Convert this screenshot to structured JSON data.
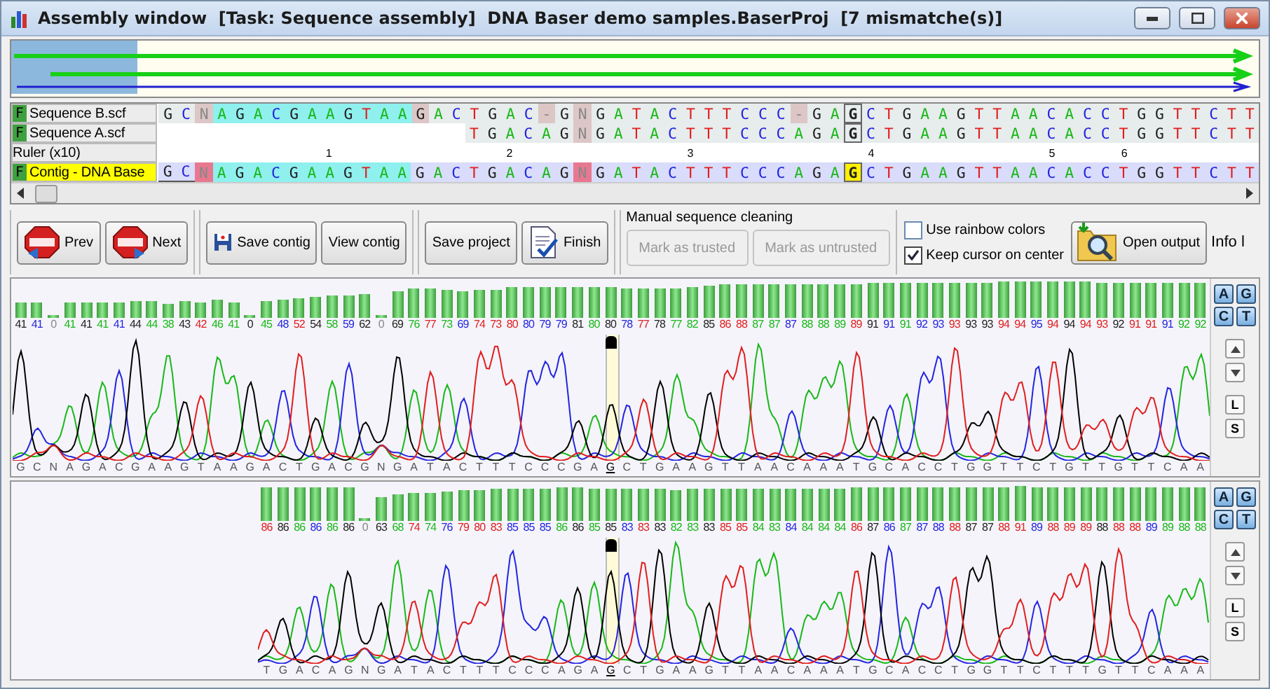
{
  "window": {
    "title": "Assembly window  [Task: Sequence assembly]  DNA Baser demo samples.BaserProj  [7 mismatche(s)]"
  },
  "alignment": {
    "rows": [
      {
        "kind": "sequence",
        "badge": "F",
        "name": "Sequence B.scf",
        "segments": [
          {
            "bases": "G C",
            "kind": "plain"
          },
          {
            "bases": "N",
            "kind": "mismatch"
          },
          {
            "bases": "A G A C G A A G T A A",
            "kind": "match"
          },
          {
            "bases": "G",
            "kind": "mismatch"
          },
          {
            "bases": "A C T G A C",
            "kind": "plain"
          },
          {
            "bases": "-",
            "kind": "mismatch"
          },
          {
            "bases": "G",
            "kind": "plain"
          },
          {
            "bases": "N",
            "kind": "mismatch"
          },
          {
            "bases": "G A T A C T T T C C C",
            "kind": "plain"
          },
          {
            "bases": "-",
            "kind": "mismatch"
          },
          {
            "bases": "G A",
            "kind": "plain"
          },
          {
            "bases": "G",
            "kind": "cursor"
          },
          {
            "bases": "C T G A A G T T A A C A C C T G G T T C T T",
            "kind": "plain"
          }
        ]
      },
      {
        "kind": "sequence",
        "badge": "F",
        "name": "Sequence A.scf",
        "segments": [
          {
            "bases": "T G A C A G",
            "kind": "plain"
          },
          {
            "bases": "N",
            "kind": "mismatch"
          },
          {
            "bases": "G A T A C T T T C C C A G A",
            "kind": "plain"
          },
          {
            "bases": "G",
            "kind": "cursor"
          },
          {
            "bases": "C T G A A G T T A A C A C C T G G T T C T T",
            "kind": "plain"
          }
        ]
      },
      {
        "kind": "ruler",
        "name": "Ruler (x10)",
        "marks": [
          "1",
          "2",
          "3",
          "4",
          "5",
          "6"
        ]
      },
      {
        "kind": "contig",
        "badge": "F",
        "name": "Contig - DNA Base",
        "segments": [
          {
            "bases": "G C",
            "kind": "trimmed"
          },
          {
            "bases": "N",
            "kind": "error"
          },
          {
            "bases": "A G A C G A A G T A A",
            "kind": "match"
          },
          {
            "bases": "G A C T G A C A G",
            "kind": "contig"
          },
          {
            "bases": "N",
            "kind": "error"
          },
          {
            "bases": "G A T A C T T T C C C A G A",
            "kind": "contig"
          },
          {
            "bases": "G",
            "kind": "cursor-marked"
          },
          {
            "bases": "C T G A A G T T A A C A C C T G G T T C T T",
            "kind": "contig"
          }
        ]
      }
    ]
  },
  "toolbar": {
    "groups": [
      {
        "buttons": [
          {
            "label": "Prev"
          },
          {
            "label": "Next"
          }
        ]
      },
      {
        "buttons": [
          {
            "label": "Save contig"
          },
          {
            "label": "View contig"
          }
        ]
      },
      {
        "buttons": [
          {
            "label": "Save project"
          },
          {
            "label": "Finish"
          }
        ]
      }
    ],
    "cleaning": {
      "title": "Manual sequence cleaning",
      "buttons": [
        {
          "label": "Mark as trusted",
          "disabled": true
        },
        {
          "label": "Mark as untrusted",
          "disabled": true
        }
      ]
    },
    "options": [
      {
        "label": "Use rainbow colors",
        "checked": false
      },
      {
        "label": "Keep cursor on center",
        "checked": true
      }
    ],
    "output_button": {
      "label": "Open output"
    },
    "info_label": "Info l"
  },
  "chromatograms": [
    {
      "side_buttons": [
        "A",
        "G",
        "C",
        "T"
      ],
      "buttons": [
        "L",
        "S"
      ],
      "calls": [
        {
          "b": "G",
          "q": "41"
        },
        {
          "b": "C",
          "q": "41"
        },
        {
          "b": "N",
          "q": "0"
        },
        {
          "b": "A",
          "q": "41"
        },
        {
          "b": "G",
          "q": "41"
        },
        {
          "b": "A",
          "q": "41"
        },
        {
          "b": "C",
          "q": "41"
        },
        {
          "b": "G",
          "q": "44"
        },
        {
          "b": "A",
          "q": "44"
        },
        {
          "b": "A",
          "q": "38"
        },
        {
          "b": "G",
          "q": "43"
        },
        {
          "b": "T",
          "q": "42"
        },
        {
          "b": "A",
          "q": "46"
        },
        {
          "b": "A",
          "q": "41"
        },
        {
          "b": "G",
          "q": "0"
        },
        {
          "b": "A",
          "q": "45"
        },
        {
          "b": "C",
          "q": "48"
        },
        {
          "b": "T",
          "q": "52"
        },
        {
          "b": "G",
          "q": "54"
        },
        {
          "b": "A",
          "q": "58"
        },
        {
          "b": "C",
          "q": "59"
        },
        {
          "b": "G",
          "q": "62"
        },
        {
          "b": "N",
          "q": "0"
        },
        {
          "b": "G",
          "q": "69"
        },
        {
          "b": "A",
          "q": "76"
        },
        {
          "b": "T",
          "q": "77"
        },
        {
          "b": "A",
          "q": "73"
        },
        {
          "b": "C",
          "q": "69"
        },
        {
          "b": "T",
          "q": "74"
        },
        {
          "b": "T",
          "q": "73"
        },
        {
          "b": "T",
          "q": "80"
        },
        {
          "b": "C",
          "q": "80"
        },
        {
          "b": "C",
          "q": "79"
        },
        {
          "b": "C",
          "q": "79"
        },
        {
          "b": "G",
          "q": "81"
        },
        {
          "b": "A",
          "q": "80"
        },
        {
          "b": "G",
          "q": "80",
          "cursor": true
        },
        {
          "b": "C",
          "q": "78"
        },
        {
          "b": "T",
          "q": "77"
        },
        {
          "b": "G",
          "q": "78"
        },
        {
          "b": "A",
          "q": "77"
        },
        {
          "b": "A",
          "q": "82"
        },
        {
          "b": "G",
          "q": "85"
        },
        {
          "b": "T",
          "q": "86"
        },
        {
          "b": "T",
          "q": "88"
        },
        {
          "b": "A",
          "q": "87"
        },
        {
          "b": "A",
          "q": "87"
        },
        {
          "b": "C",
          "q": "87"
        },
        {
          "b": "A",
          "q": "88"
        },
        {
          "b": "A",
          "q": "88"
        },
        {
          "b": "A",
          "q": "89"
        },
        {
          "b": "T",
          "q": "89"
        },
        {
          "b": "G",
          "q": "91"
        },
        {
          "b": "C",
          "q": "91"
        },
        {
          "b": "A",
          "q": "91"
        },
        {
          "b": "C",
          "q": "92"
        },
        {
          "b": "C",
          "q": "93"
        },
        {
          "b": "T",
          "q": "93"
        },
        {
          "b": "G",
          "q": "93"
        },
        {
          "b": "G",
          "q": "93"
        },
        {
          "b": "T",
          "q": "94"
        },
        {
          "b": "T",
          "q": "94"
        },
        {
          "b": "C",
          "q": "95"
        },
        {
          "b": "T",
          "q": "94"
        },
        {
          "b": "G",
          "q": "94"
        },
        {
          "b": "T",
          "q": "94"
        },
        {
          "b": "T",
          "q": "93"
        },
        {
          "b": "G",
          "q": "92"
        },
        {
          "b": "T",
          "q": "91"
        },
        {
          "b": "T",
          "q": "91"
        },
        {
          "b": "C",
          "q": "91"
        },
        {
          "b": "A",
          "q": "92"
        },
        {
          "b": "A",
          "q": "92"
        }
      ]
    },
    {
      "side_buttons": [
        "A",
        "G",
        "C",
        "T"
      ],
      "buttons": [
        "L",
        "S"
      ],
      "calls": [
        {
          "b": "T",
          "q": "86"
        },
        {
          "b": "G",
          "q": "86"
        },
        {
          "b": "A",
          "q": "86"
        },
        {
          "b": "C",
          "q": "86"
        },
        {
          "b": "A",
          "q": "86"
        },
        {
          "b": "G",
          "q": "86"
        },
        {
          "b": "N",
          "q": "0"
        },
        {
          "b": "G",
          "q": "63"
        },
        {
          "b": "A",
          "q": "68"
        },
        {
          "b": "T",
          "q": "74"
        },
        {
          "b": "A",
          "q": "74"
        },
        {
          "b": "C",
          "q": "76"
        },
        {
          "b": "T",
          "q": "79"
        },
        {
          "b": "T",
          "q": "80"
        },
        {
          "b": "T",
          "q": "83"
        },
        {
          "b": "C",
          "q": "85"
        },
        {
          "b": "C",
          "q": "85"
        },
        {
          "b": "C",
          "q": "85"
        },
        {
          "b": "A",
          "q": "86"
        },
        {
          "b": "G",
          "q": "86"
        },
        {
          "b": "A",
          "q": "85"
        },
        {
          "b": "G",
          "q": "85",
          "cursor": true
        },
        {
          "b": "C",
          "q": "83"
        },
        {
          "b": "T",
          "q": "83"
        },
        {
          "b": "G",
          "q": "83"
        },
        {
          "b": "A",
          "q": "82"
        },
        {
          "b": "A",
          "q": "83"
        },
        {
          "b": "G",
          "q": "83"
        },
        {
          "b": "T",
          "q": "85"
        },
        {
          "b": "T",
          "q": "85"
        },
        {
          "b": "A",
          "q": "84"
        },
        {
          "b": "A",
          "q": "83"
        },
        {
          "b": "C",
          "q": "84"
        },
        {
          "b": "A",
          "q": "84"
        },
        {
          "b": "A",
          "q": "84"
        },
        {
          "b": "A",
          "q": "84"
        },
        {
          "b": "T",
          "q": "86"
        },
        {
          "b": "G",
          "q": "87"
        },
        {
          "b": "C",
          "q": "86"
        },
        {
          "b": "A",
          "q": "87"
        },
        {
          "b": "C",
          "q": "87"
        },
        {
          "b": "C",
          "q": "88"
        },
        {
          "b": "T",
          "q": "88"
        },
        {
          "b": "G",
          "q": "87"
        },
        {
          "b": "G",
          "q": "87"
        },
        {
          "b": "T",
          "q": "88"
        },
        {
          "b": "T",
          "q": "91"
        },
        {
          "b": "C",
          "q": "89"
        },
        {
          "b": "T",
          "q": "88"
        },
        {
          "b": "T",
          "q": "89"
        },
        {
          "b": "T",
          "q": "89"
        },
        {
          "b": "G",
          "q": "88"
        },
        {
          "b": "T",
          "q": "88"
        },
        {
          "b": "T",
          "q": "88"
        },
        {
          "b": "C",
          "q": "89"
        },
        {
          "b": "A",
          "q": "89"
        },
        {
          "b": "A",
          "q": "88"
        },
        {
          "b": "A",
          "q": "88"
        }
      ]
    }
  ]
}
